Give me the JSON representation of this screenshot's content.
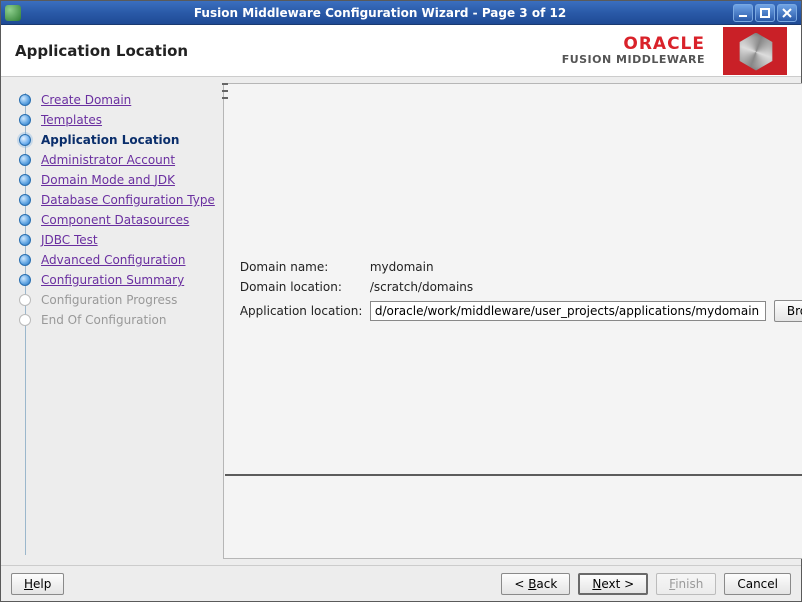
{
  "window": {
    "title": "Fusion Middleware Configuration Wizard - Page 3 of 12"
  },
  "header": {
    "page_title": "Application Location",
    "brand_top": "ORACLE",
    "brand_bottom": "FUSION MIDDLEWARE"
  },
  "sidebar": {
    "items": [
      {
        "label": "Create Domain",
        "state": "done",
        "mn": "C"
      },
      {
        "label": "Templates",
        "state": "done",
        "mn": "T"
      },
      {
        "label": "Application Location",
        "state": "current"
      },
      {
        "label": "Administrator Account",
        "state": "future",
        "mn": "A"
      },
      {
        "label": "Domain Mode and JDK",
        "state": "future",
        "mn": "J"
      },
      {
        "label": "Database Configuration Type",
        "state": "future",
        "mn": "D"
      },
      {
        "label": "Component Datasources",
        "state": "future",
        "mn": "C"
      },
      {
        "label": "JDBC Test",
        "state": "future",
        "mn": "J"
      },
      {
        "label": "Advanced Configuration",
        "state": "future",
        "mn": "A"
      },
      {
        "label": "Configuration Summary",
        "state": "future",
        "mn": "C"
      },
      {
        "label": "Configuration Progress",
        "state": "pending"
      },
      {
        "label": "End Of Configuration",
        "state": "pending"
      }
    ]
  },
  "form": {
    "labels": {
      "domain_name": "Domain name:",
      "domain_location": "Domain location:",
      "application_location": "Application location:"
    },
    "values": {
      "domain_name": "mydomain",
      "domain_location": "/scratch/domains",
      "application_location": "d/oracle/work/middleware/user_projects/applications/mydomain"
    },
    "browse_label": "Browse"
  },
  "footer": {
    "help": "Help",
    "back": "< Back",
    "next": "Next >",
    "finish": "Finish",
    "cancel": "Cancel"
  }
}
